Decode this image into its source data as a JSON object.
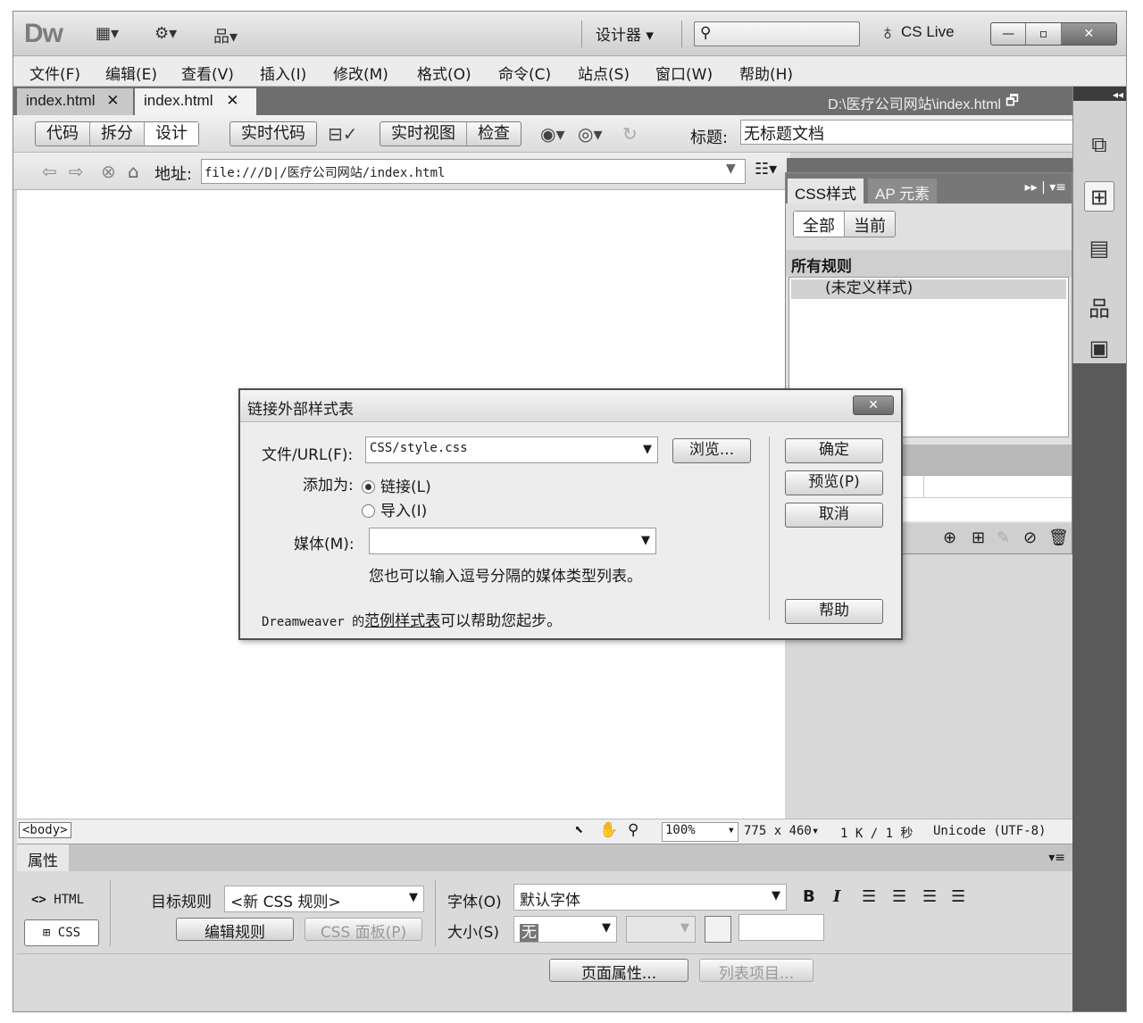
{
  "app": {
    "logo": "Dw",
    "workspace_label": "设计器",
    "cs_live": "CS Live",
    "window_buttons": [
      "—",
      "▫",
      "✕"
    ]
  },
  "menu": [
    "文件(F)",
    "编辑(E)",
    "查看(V)",
    "插入(I)",
    "修改(M)",
    "格式(O)",
    "命令(C)",
    "站点(S)",
    "窗口(W)",
    "帮助(H)"
  ],
  "tabs": [
    {
      "label": "index.html",
      "close": "✕"
    },
    {
      "label": "index.html",
      "close": "✕"
    }
  ],
  "doc_path": "D:\\医疗公司网站\\index.html",
  "doc_toolbar": {
    "views": [
      "代码",
      "拆分",
      "设计"
    ],
    "live_code": "实时代码",
    "live_view": "实时视图",
    "inspect": "检查",
    "title_label": "标题:",
    "title_value": "无标题文档"
  },
  "address": {
    "label": "地址:",
    "value": "file:///D|/医疗公司网站/index.html"
  },
  "status": {
    "tag": "<body>",
    "zoom": "100%",
    "size": "775 x 460",
    "filesize": "1 K / 1 秒",
    "encoding": "Unicode (UTF-8)"
  },
  "css_panel": {
    "tabs": [
      "CSS样式",
      "AP 元素"
    ],
    "modes": [
      "全部",
      "当前"
    ],
    "section": "所有规则",
    "rules": [
      "(未定义样式)"
    ]
  },
  "properties": {
    "title": "属性",
    "html_label": "HTML",
    "css_label": "CSS",
    "target_rule_label": "目标规则",
    "target_rule_value": "<新 CSS 规则>",
    "edit_rule": "编辑规则",
    "css_panel_btn": "CSS 面板(P)",
    "font_label": "字体(O)",
    "font_value": "默认字体",
    "size_label": "大小(S)",
    "size_value": "无",
    "page_props": "页面属性...",
    "list_item": "列表项目..."
  },
  "dialog": {
    "title": "链接外部样式表",
    "file_label": "文件/URL(F):",
    "file_value": "CSS/style.css",
    "browse": "浏览...",
    "add_as_label": "添加为:",
    "option_link": "链接(L)",
    "option_import": "导入(I)",
    "media_label": "媒体(M):",
    "media_value": "",
    "media_hint": "您也可以输入逗号分隔的媒体类型列表。",
    "footer_prefix": "Dreamweaver 的",
    "footer_link": "范例样式表",
    "footer_suffix": "可以帮助您起步。",
    "ok": "确定",
    "preview": "预览(P)",
    "cancel": "取消",
    "help": "帮助"
  }
}
